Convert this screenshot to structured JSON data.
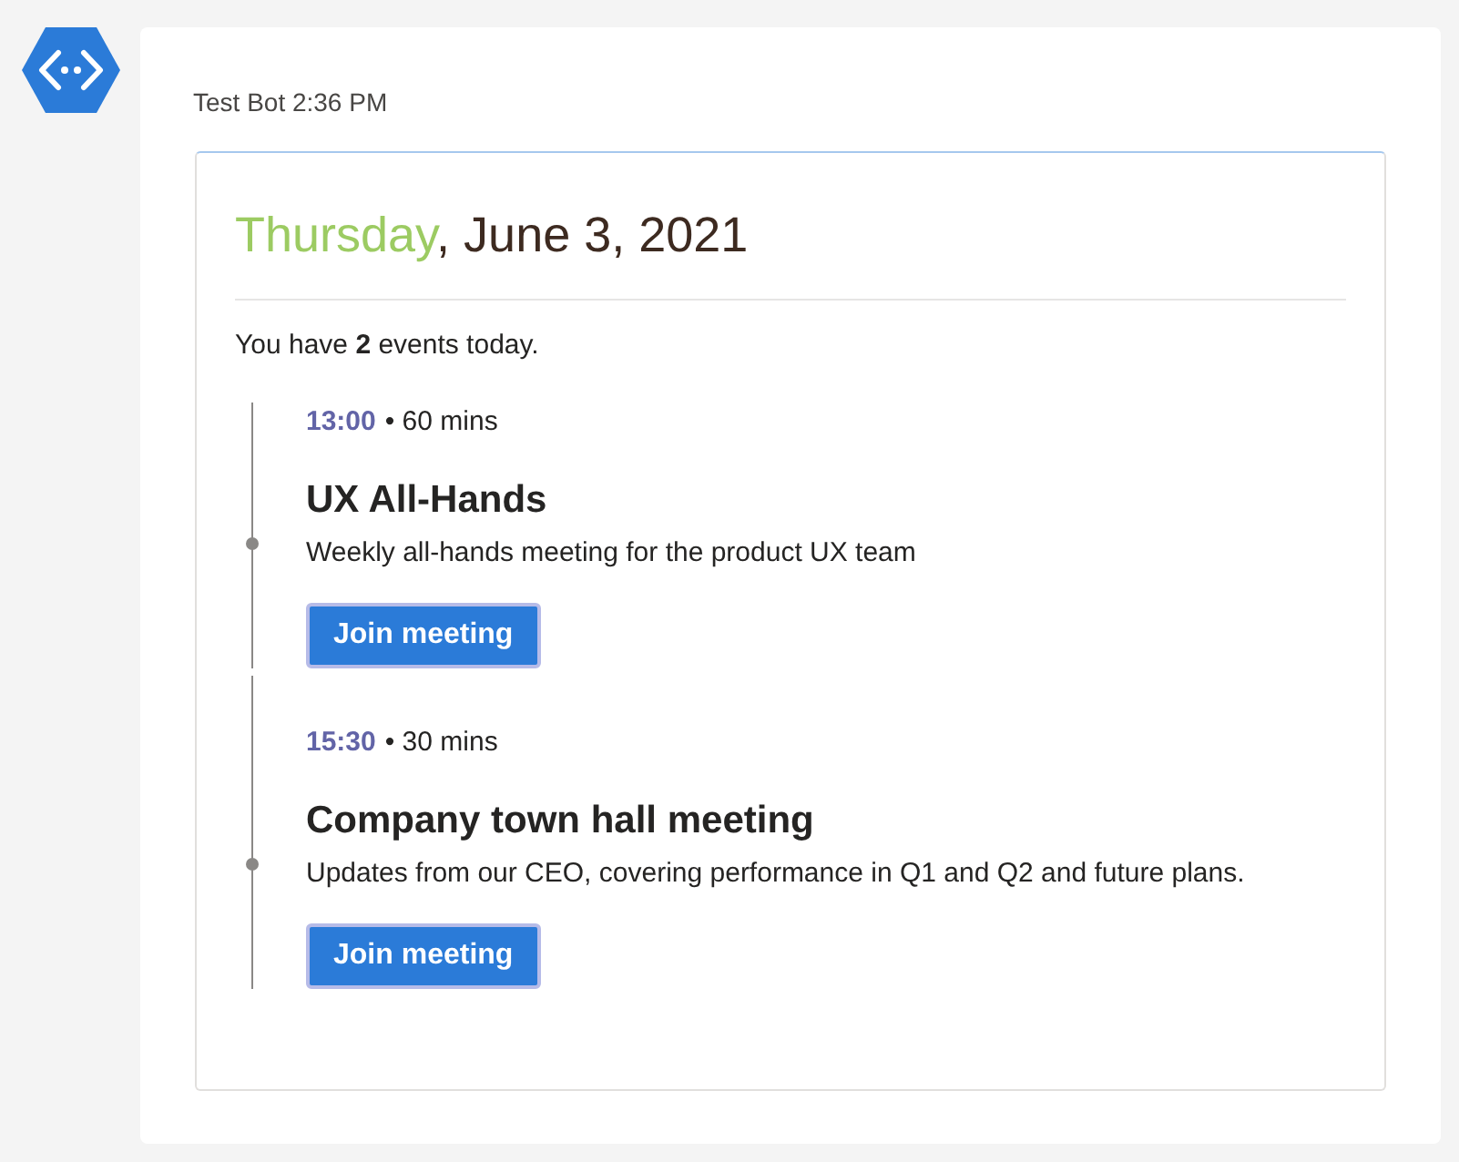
{
  "message": {
    "header": "Test Bot 2:36 PM",
    "card": {
      "date_heading": {
        "highlighted": "Thursday",
        "remainder": ", June 3, 2021"
      },
      "summary": "You have **2** events today.",
      "events": [
        {
          "start": "13:00",
          "duration": "• 60 mins",
          "title": "UX All-Hands",
          "description": "Weekly all-hands meeting for the product UX team",
          "button": "Join meeting"
        },
        {
          "start": "15:30",
          "duration": "• 30 mins",
          "title": "Company town hall meeting",
          "description": "Updates from our CEO, covering performance in Q1 and Q2 and future plans.",
          "button": "Join meeting"
        }
      ]
    }
  }
}
